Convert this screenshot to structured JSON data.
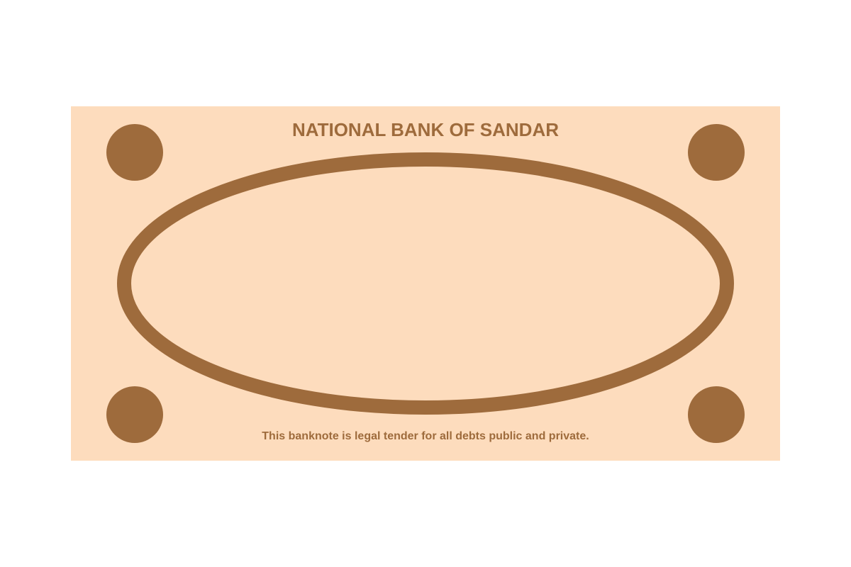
{
  "banknote": {
    "bank_name": "NATIONAL BANK OF SANDAR",
    "legal_text": "This banknote is legal tender for all debts public and private."
  },
  "colors": {
    "paper": "#fddcbd",
    "ink": "#9e6b3c",
    "background": "#ffffff"
  }
}
